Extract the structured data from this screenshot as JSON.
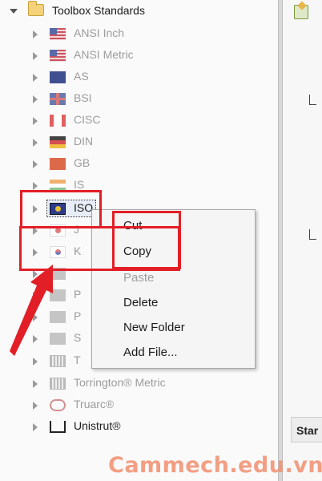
{
  "tree": {
    "root_label": "Toolbox Standards",
    "items": [
      {
        "label": "ANSI Inch",
        "icon": "us-flag-icon"
      },
      {
        "label": "ANSI Metric",
        "icon": "us-flag-icon"
      },
      {
        "label": "AS",
        "icon": "australia-flag-icon"
      },
      {
        "label": "BSI",
        "icon": "uk-flag-icon"
      },
      {
        "label": "CISC",
        "icon": "canada-flag-icon"
      },
      {
        "label": "DIN",
        "icon": "germany-flag-icon"
      },
      {
        "label": "GB",
        "icon": "china-flag-icon"
      },
      {
        "label": "IS",
        "icon": "india-flag-icon"
      },
      {
        "label": "ISO",
        "icon": "iso-icon"
      },
      {
        "label": "J",
        "icon": "japan-flag-icon"
      },
      {
        "label": "K",
        "icon": "korea-flag-icon"
      },
      {
        "label": "",
        "icon": "standard-icon"
      },
      {
        "label": "P",
        "icon": "standard-icon"
      },
      {
        "label": "P",
        "icon": "pem-icon"
      },
      {
        "label": "S",
        "icon": "skf-icon"
      },
      {
        "label": "T",
        "icon": "grid-icon"
      },
      {
        "label": "Torrington® Metric",
        "icon": "grid-icon"
      },
      {
        "label": "Truarc®",
        "icon": "rings-icon"
      },
      {
        "label": "Unistrut®",
        "icon": "unistrut-icon"
      }
    ]
  },
  "context_menu": {
    "items": [
      "Cut",
      "Copy",
      "Paste",
      "Delete",
      "New Folder",
      "Add File..."
    ],
    "disabled": [
      "Paste"
    ]
  },
  "right_panel": {
    "column_header": "Star"
  },
  "watermark": "Cammech.edu.vn",
  "colors": {
    "highlight": "#e21f26",
    "watermark": "#f28f6f"
  }
}
